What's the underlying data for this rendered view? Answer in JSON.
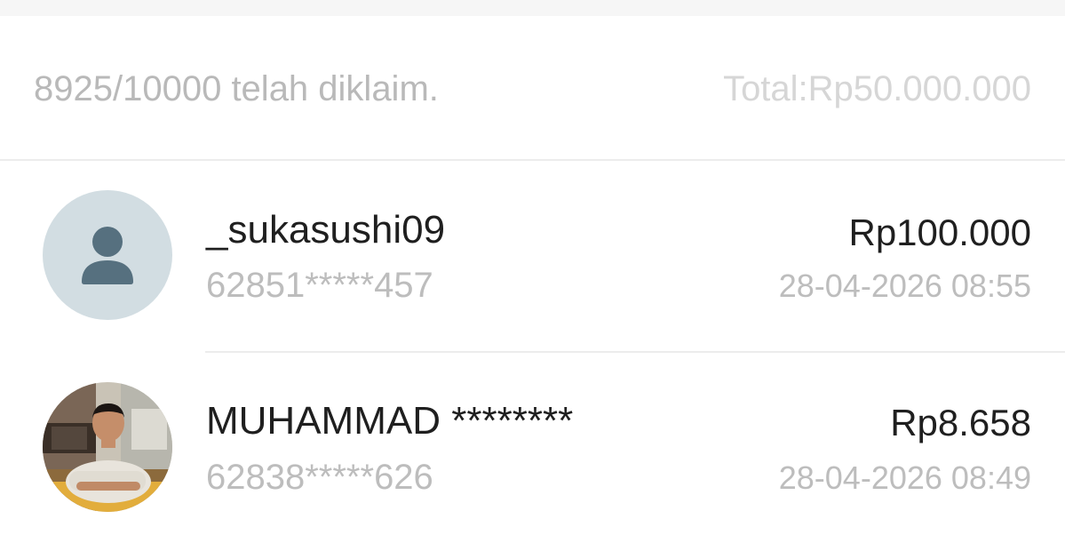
{
  "summary": {
    "claimed_text": "8925/10000 telah diklaim.",
    "total_text": "Total:Rp50.000.000"
  },
  "claims": [
    {
      "name": "_sukasushi09",
      "phone": "62851*****457",
      "amount": "Rp100.000",
      "timestamp": "28-04-2026 08:55",
      "avatar": "default-user-icon"
    },
    {
      "name": "MUHAMMAD ********",
      "phone": "62838*****626",
      "amount": "Rp8.658",
      "timestamp": "28-04-2026 08:49",
      "avatar": "user-photo"
    }
  ],
  "colors": {
    "primary_text": "#1f1f1f",
    "secondary_text": "#bdbdbd",
    "avatar_bg": "#d2dde2",
    "avatar_icon": "#56707f"
  }
}
